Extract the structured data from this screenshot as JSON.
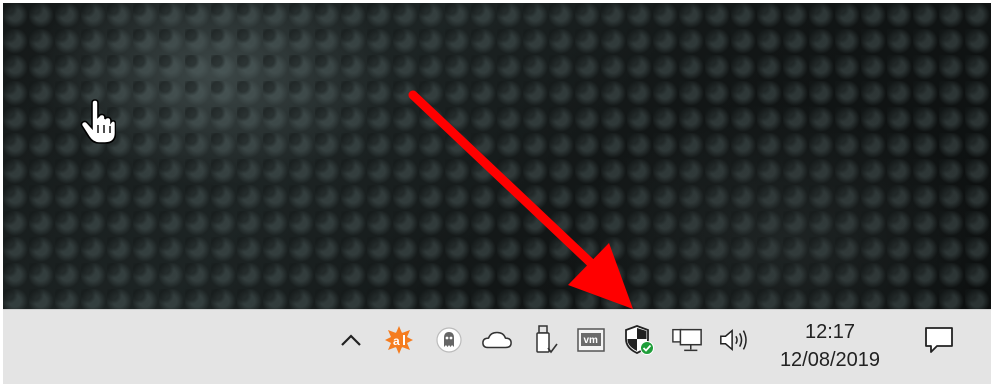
{
  "taskbar": {
    "clock": {
      "time": "12:17",
      "date": "12/08/2019"
    },
    "tray_icons": [
      "chevron-up-icon",
      "avast-icon",
      "ghostery-icon",
      "onedrive-icon",
      "usb-eject-icon",
      "vmware-icon",
      "windows-security-icon",
      "network-icon",
      "volume-icon",
      "action-center-icon"
    ],
    "vmware_label": "vm"
  },
  "annotation": {
    "arrow_color": "#ff0000"
  },
  "colors": {
    "taskbar_bg": "#e4e4e4",
    "avast_orange": "#f57c1f",
    "security_green": "#1f9e3a"
  }
}
